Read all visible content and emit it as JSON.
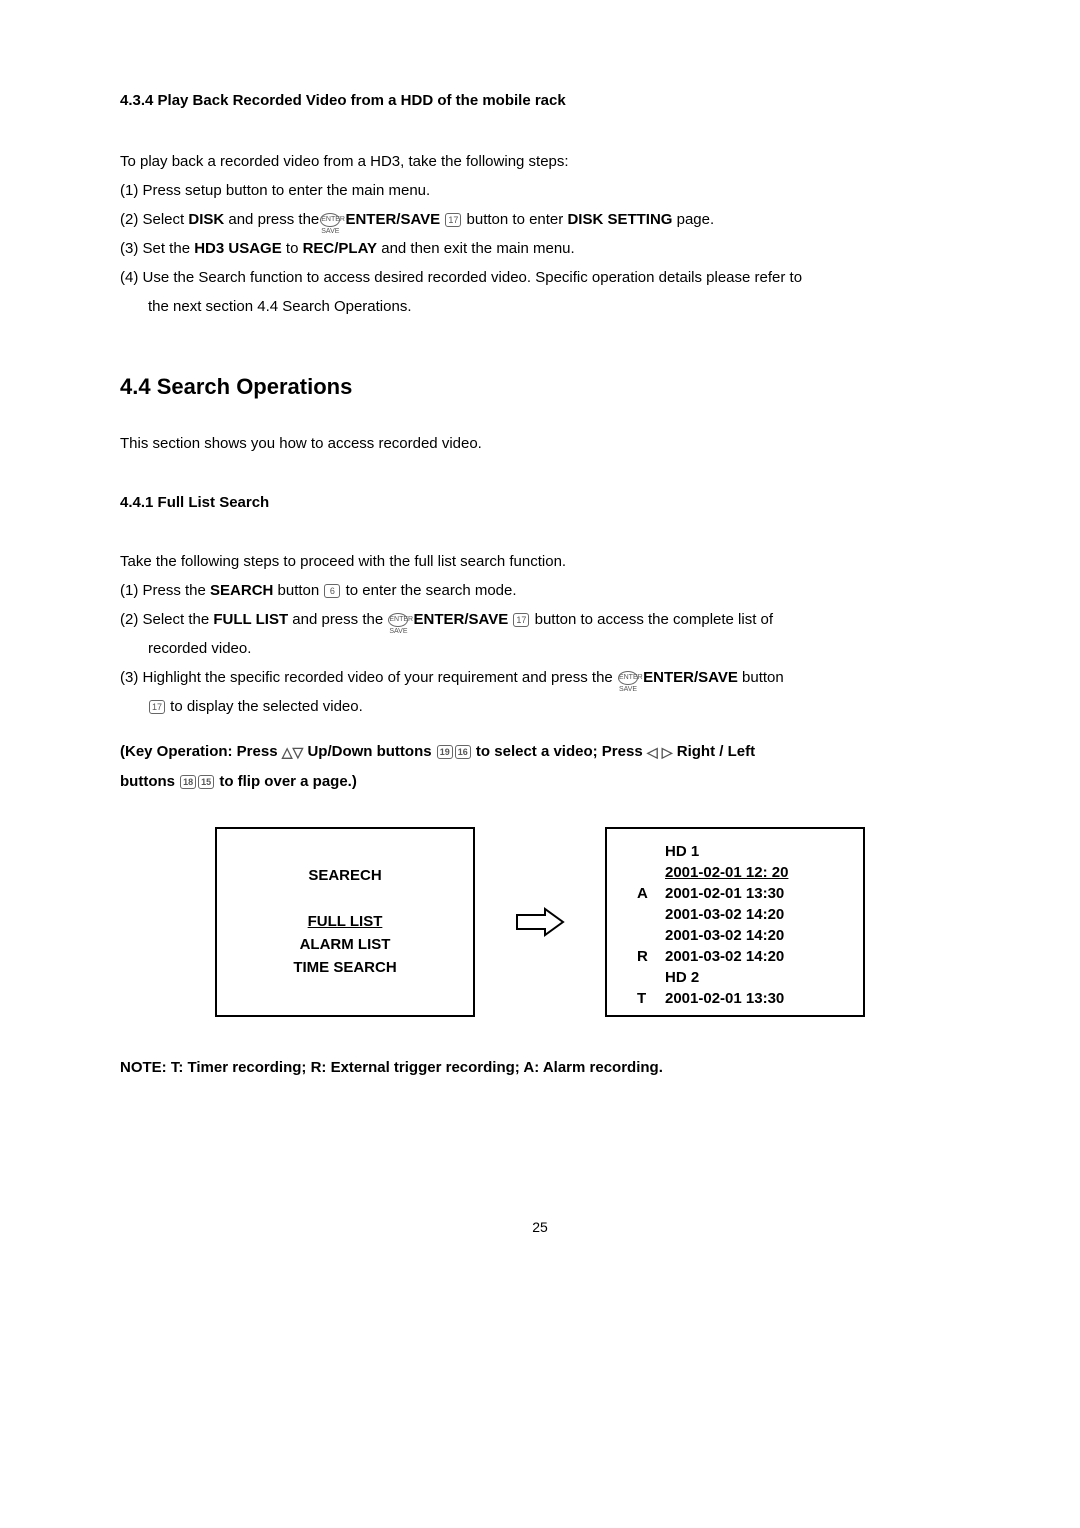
{
  "section_434": {
    "heading": "4.3.4 Play Back Recorded Video from a HDD of the mobile rack",
    "intro": "To play back a recorded video from a HD3, take the following steps:",
    "step1": "(1) Press setup button to enter the main menu.",
    "step2_a": "(2) Select ",
    "step2_disk": "DISK",
    "step2_b": " and press the",
    "step2_c": " ",
    "step2_enter": "ENTER/SAVE",
    "step2_d": " button to enter ",
    "step2_disksetting": "DISK SETTING",
    "step2_e": " page.",
    "step3_a": "(3) Set the ",
    "step3_hd3": "HD3 USAGE",
    "step3_b": " to ",
    "step3_rec": "REC/PLAY",
    "step3_c": " and then exit the main menu.",
    "step4_a": "(4) Use the Search function to access desired recorded video. Specific operation details please refer to",
    "step4_b": "the next section 4.4 Search Operations.",
    "icon_enter": "ENTER SAVE",
    "icon_17": "17"
  },
  "section_44": {
    "heading": "4.4 Search Operations",
    "intro": "This section shows you how to access recorded video."
  },
  "section_441": {
    "heading": "4.4.1 Full List Search",
    "intro": "Take the following steps to proceed with the full list search function.",
    "step1_a": "(1) Press the ",
    "step1_search": "SEARCH",
    "step1_b": " button ",
    "step1_c": " to enter the search mode.",
    "step2_a": "(2) Select the ",
    "step2_full": "FULL LIST",
    "step2_b": " and press the ",
    "step2_enter": "ENTER/SAVE",
    "step2_c": " button to access the complete list of",
    "step2_d": "recorded video.",
    "step3_a": "(3) Highlight the specific recorded video of your requirement and press the ",
    "step3_enter": "ENTER/SAVE",
    "step3_b": " button",
    "step3_c": " to display the selected video.",
    "icon_6": "6",
    "icon_enter": "ENTER SAVE",
    "icon_17": "17"
  },
  "key_op": {
    "part1": "(Key Operation: Press ",
    "updown": " Up/Down buttons ",
    "part2": " to select a video; Press ",
    "rightleft": " Right / Left",
    "part3": "buttons ",
    "part4": " to flip over a page.)",
    "icon_19": "19",
    "icon_16": "16",
    "icon_18": "18",
    "icon_15": "15"
  },
  "diagram": {
    "left": {
      "title": "SEARECH",
      "item1": "FULL LIST",
      "item2": "ALARM LIST",
      "item3": "TIME SEARCH"
    },
    "right": {
      "rows": [
        {
          "a": "",
          "b": "HD 1"
        },
        {
          "a": "",
          "b": "2001-02-01 12: 20",
          "underline": true
        },
        {
          "a": "A",
          "b": "2001-02-01 13:30"
        },
        {
          "a": "",
          "b": "2001-03-02 14:20"
        },
        {
          "a": "",
          "b": "2001-03-02 14:20"
        },
        {
          "a": "R",
          "b": "2001-03-02 14:20"
        },
        {
          "a": "",
          "b": "HD 2"
        },
        {
          "a": "T",
          "b": "2001-02-01 13:30"
        }
      ]
    }
  },
  "note": "NOTE:  T: Timer recording; R: External trigger recording; A: Alarm recording.",
  "page_num": "25"
}
